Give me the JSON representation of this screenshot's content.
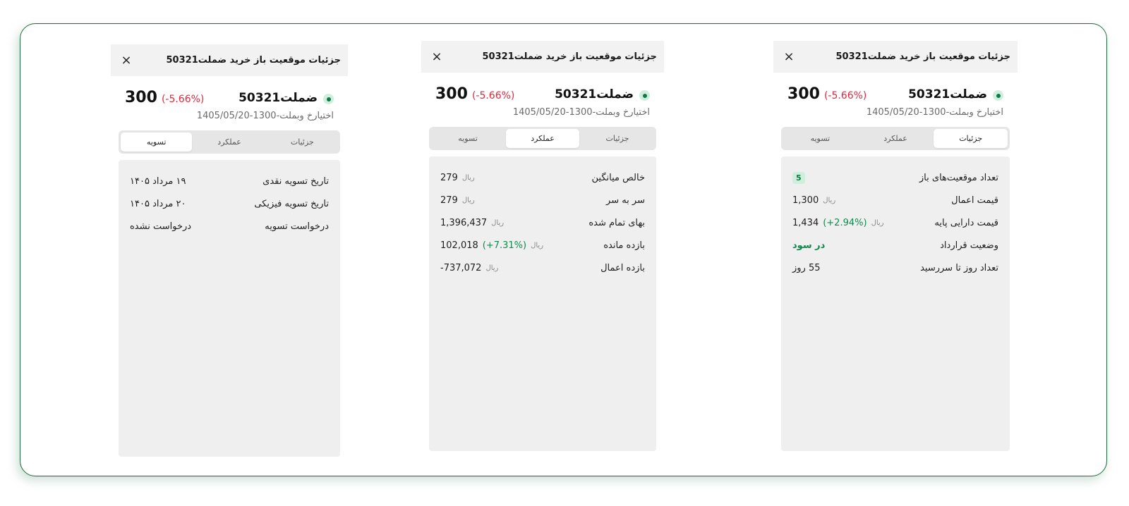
{
  "panels": [
    {
      "title": "جزئیات موقعیت باز خرید ضملت50321",
      "close": "×",
      "symbol": "ضملت50321",
      "price": "300",
      "change": "(-5.66%)",
      "subtitle": "اختیارخ وبملت-1300-1405/05/20",
      "tabs": [
        "جزئیات",
        "عملکرد",
        "تسویه"
      ],
      "active_tab": 0,
      "rows": [
        {
          "label": "تعداد موقعیت‌های باز",
          "value": "5"
        },
        {
          "label": "قیمت اعمال",
          "value": "1,300",
          "unit": "ریال"
        },
        {
          "label": "قیمت دارایی پایه",
          "value": "1,434",
          "pct": "(+2.94%)",
          "unit": "ریال"
        },
        {
          "label": "وضعیت قرارداد",
          "value": "در سود"
        },
        {
          "label": "تعداد روز تا سررسید",
          "value": "55 روز"
        }
      ]
    },
    {
      "title": "جزئیات موقعیت باز خرید ضملت50321",
      "close": "×",
      "symbol": "ضملت50321",
      "price": "300",
      "change": "(-5.66%)",
      "subtitle": "اختیارخ وبملت-1300-1405/05/20",
      "tabs": [
        "جزئیات",
        "عملکرد",
        "تسویه"
      ],
      "active_tab": 1,
      "rows": [
        {
          "label": "خالص میانگین",
          "value": "279",
          "unit": "ریال"
        },
        {
          "label": "سر به سر",
          "value": "279",
          "unit": "ریال"
        },
        {
          "label": "بهای تمام شده",
          "value": "1,396,437",
          "unit": "ریال"
        },
        {
          "label": "بازده مانده",
          "value": "102,018",
          "pct": "(+7.31%)",
          "unit": "ریال"
        },
        {
          "label": "بازده اعمال",
          "value": "-737,072",
          "unit": "ریال"
        }
      ]
    },
    {
      "title": "جزئیات موقعیت باز خرید ضملت50321",
      "close": "×",
      "symbol": "ضملت50321",
      "price": "300",
      "change": "(-5.66%)",
      "subtitle": "اختیارخ وبملت-1300-1405/05/20",
      "tabs": [
        "جزئیات",
        "عملکرد",
        "تسویه"
      ],
      "active_tab": 2,
      "rows": [
        {
          "label": "تاریخ تسویه نقدی",
          "value": "۱۹ مرداد ۱۴۰۵"
        },
        {
          "label": "تاریخ تسویه فیزیکی",
          "value": "۲۰ مرداد ۱۴۰۵"
        },
        {
          "label": "درخواست تسویه",
          "value": "درخواست نشده"
        }
      ]
    }
  ],
  "colors": {
    "frame_border": "#1e6b3f",
    "positive": "#0f8a4e",
    "negative": "#e0283c",
    "status_dot": "#0f7a45"
  }
}
